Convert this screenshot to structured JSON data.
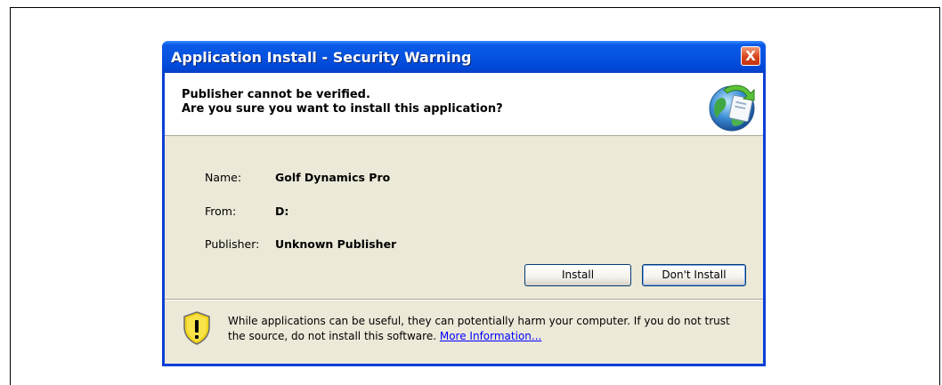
{
  "window": {
    "title": "Application Install - Security Warning",
    "close_label": "X"
  },
  "header": {
    "line1": "Publisher cannot be verified.",
    "line2": "Are you sure you want to install this application?",
    "icon": "globe-install-icon"
  },
  "details": [
    {
      "label": "Name:",
      "value": "Golf Dynamics Pro"
    },
    {
      "label": "From:",
      "value": "D:"
    },
    {
      "label": "Publisher:",
      "value": "Unknown Publisher"
    }
  ],
  "buttons": {
    "install": "Install",
    "dont_install": "Don't Install"
  },
  "warning": {
    "text": "While applications can be useful, they can potentially harm your computer. If you do not trust the source, do not install this software.",
    "link": "More Information...",
    "icon": "shield-warning-icon"
  },
  "colors": {
    "titlebar": "#0752e0",
    "client": "#ece9d8",
    "close": "#d8441c"
  }
}
